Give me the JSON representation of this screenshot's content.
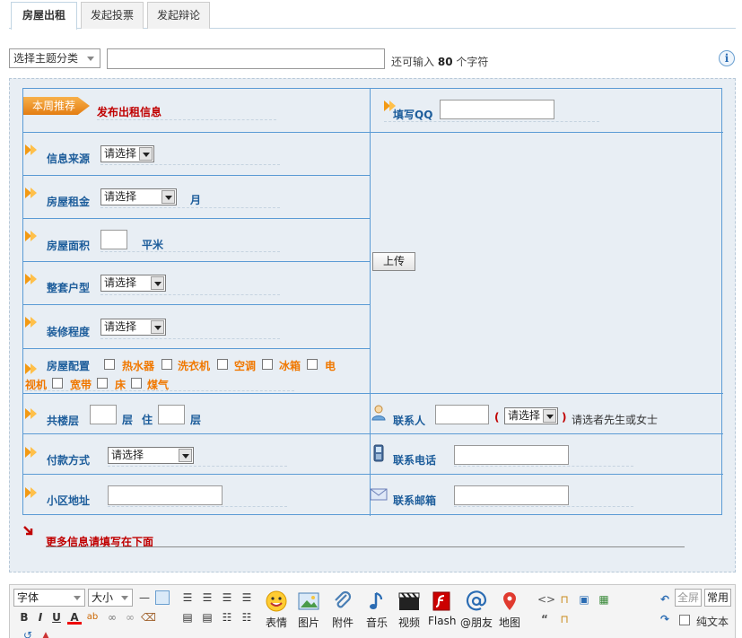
{
  "tabs": [
    {
      "label": "房屋出租",
      "active": true
    },
    {
      "label": "发起投票",
      "active": false
    },
    {
      "label": "发起辩论",
      "active": false
    }
  ],
  "subject": {
    "category_select": "选择主题分类",
    "title_value": "",
    "hint_prefix": "还可输入",
    "hint_count": "80",
    "hint_suffix": "个字符",
    "info_icon": "info-icon"
  },
  "form": {
    "badge": "本周推荐",
    "heading": "发布出租信息",
    "qq_label": "填写QQ",
    "source_label": "信息来源",
    "rent_label": "房屋租金",
    "rent_unit": "月",
    "area_label": "房屋面积",
    "area_unit": "平米",
    "layout_label": "整套户型",
    "decoration_label": "装修程度",
    "amenities_label": "房屋配置",
    "amenities": [
      "热水器",
      "洗衣机",
      "空调",
      "冰箱",
      "电视机",
      "宽带",
      "床",
      "煤气"
    ],
    "floor_label": "共楼层",
    "floor_unit_1": "层",
    "floor_unit_2": "住",
    "floor_unit_3": "层",
    "payment_label": "付款方式",
    "address_label": "小区地址",
    "contact_label": "联系人",
    "gender_hint": "请选者先生或女士",
    "phone_label": "联系电话",
    "email_label": "联系邮箱",
    "select_placeholder": "请选择",
    "upload_label": "上传",
    "more_info": "更多信息请填写在下面"
  },
  "toolbar": {
    "font_select": "字体",
    "size_select": "大小",
    "big_buttons": [
      "表情",
      "图片",
      "附件",
      "音乐",
      "视频",
      "Flash",
      "@朋友",
      "地图"
    ],
    "fullscreen": "全屏",
    "common": "常用",
    "plain_text": "纯文本"
  },
  "colors": {
    "accent": "#1d5d9b",
    "border": "#5b9bd5",
    "amenity": "#f07800",
    "heading_red": "#c00000"
  }
}
